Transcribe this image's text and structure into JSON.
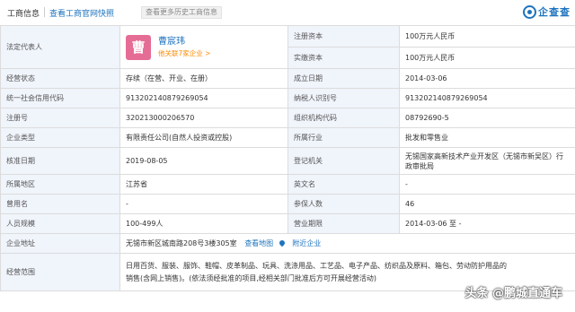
{
  "header": {
    "title": "工商信息",
    "link": "查看工商官网快照",
    "badge": "查看更多历史工商信息",
    "logo": "企查查"
  },
  "legal_rep": {
    "label": "法定代表人",
    "avatar_char": "曹",
    "name": "曹宸玮",
    "related": "他关联7家企业 >"
  },
  "rows": [
    [
      "注册资本",
      "100万元人民币"
    ],
    [
      "实缴资本",
      "100万元人民币"
    ],
    [
      "经营状态",
      "存续（在营、开业、在册）",
      "成立日期",
      "2014-03-06"
    ],
    [
      "统一社会信用代码",
      "913202140879269054",
      "纳税人识别号",
      "913202140879269054"
    ],
    [
      "注册号",
      "320213000206570",
      "组织机构代码",
      "08792690-5"
    ],
    [
      "企业类型",
      "有限责任公司(自然人投资或控股)",
      "所属行业",
      "批发和零售业"
    ],
    [
      "核准日期",
      "2019-08-05",
      "登记机关",
      "无锡国家高新技术产业开发区（无锡市新吴区）行政审批局"
    ],
    [
      "所属地区",
      "江苏省",
      "英文名",
      "-"
    ],
    [
      "曾用名",
      "-",
      "参保人数",
      "46"
    ],
    [
      "人员规模",
      "100-499人",
      "营业期限",
      "2014-03-06 至 -"
    ]
  ],
  "address": {
    "label": "企业地址",
    "value": "无锡市新区城南路208号3楼305室",
    "map_link": "查看地图",
    "nearby_link": "附近企业"
  },
  "scope": {
    "label": "经营范围",
    "value": "日用百货、服装、服饰、鞋帽、皮革制品、玩具、洗涤用品、工艺品、电子产品、纺织品及原料、箱包、劳动防护用品的销售(含网上销售)。(依法须经批准的项目,经相关部门批准后方可开展经营活动)"
  },
  "watermark": "头条 @鹏城直通车"
}
